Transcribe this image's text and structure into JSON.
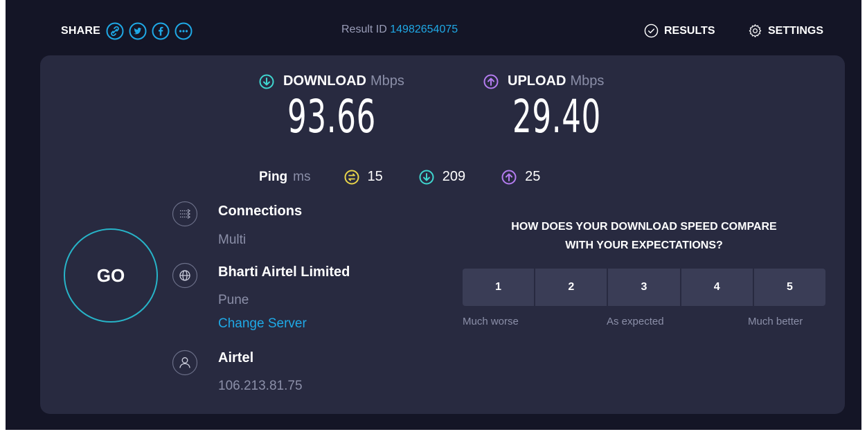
{
  "header": {
    "share_label": "SHARE",
    "share_icons": [
      "link-icon",
      "twitter-icon",
      "facebook-icon",
      "more-icon"
    ],
    "result_label": "Result ID",
    "result_id": "14982654075",
    "results_label": "RESULTS",
    "settings_label": "SETTINGS"
  },
  "download": {
    "label": "DOWNLOAD",
    "unit": "Mbps",
    "value": "93.66"
  },
  "upload": {
    "label": "UPLOAD",
    "unit": "Mbps",
    "value": "29.40"
  },
  "ping": {
    "label": "Ping",
    "unit": "ms",
    "idle": "15",
    "download": "209",
    "upload": "25"
  },
  "go_label": "GO",
  "connections": {
    "title": "Connections",
    "value": "Multi"
  },
  "server": {
    "title": "Bharti Airtel Limited",
    "location": "Pune",
    "change_label": "Change Server"
  },
  "provider": {
    "title": "Airtel",
    "ip": "106.213.81.75"
  },
  "survey": {
    "question_line1": "HOW DOES YOUR DOWNLOAD SPEED COMPARE",
    "question_line2": "WITH YOUR EXPECTATIONS?",
    "options": [
      "1",
      "2",
      "3",
      "4",
      "5"
    ],
    "low_label": "Much worse",
    "mid_label": "As expected",
    "high_label": "Much better"
  },
  "colors": {
    "background": "#141526",
    "panel": "#282a40",
    "accent_blue": "#1fa9e6",
    "download_teal": "#3fd6cf",
    "upload_purple": "#b47cf0",
    "ping_yellow": "#e9d54a",
    "muted": "#8b8fa8"
  }
}
